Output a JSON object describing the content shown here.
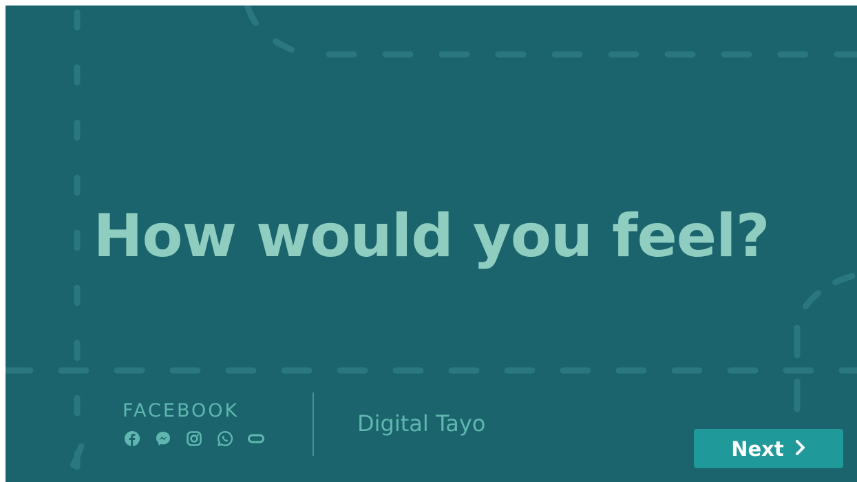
{
  "slide": {
    "headline": "How would you feel?",
    "brand": "FACEBOOK",
    "app_icons": [
      "facebook-icon",
      "messenger-icon",
      "instagram-icon",
      "whatsapp-icon",
      "oculus-icon"
    ],
    "program": "Digital Tayo"
  },
  "navigation": {
    "next_label": "Next",
    "next_icon": "chevron-right-icon"
  },
  "colors": {
    "background": "#1b636d",
    "headline": "#8ecdc0",
    "accent": "#5fb7b0",
    "button": "#1f9999",
    "button_text": "#ffffff"
  }
}
